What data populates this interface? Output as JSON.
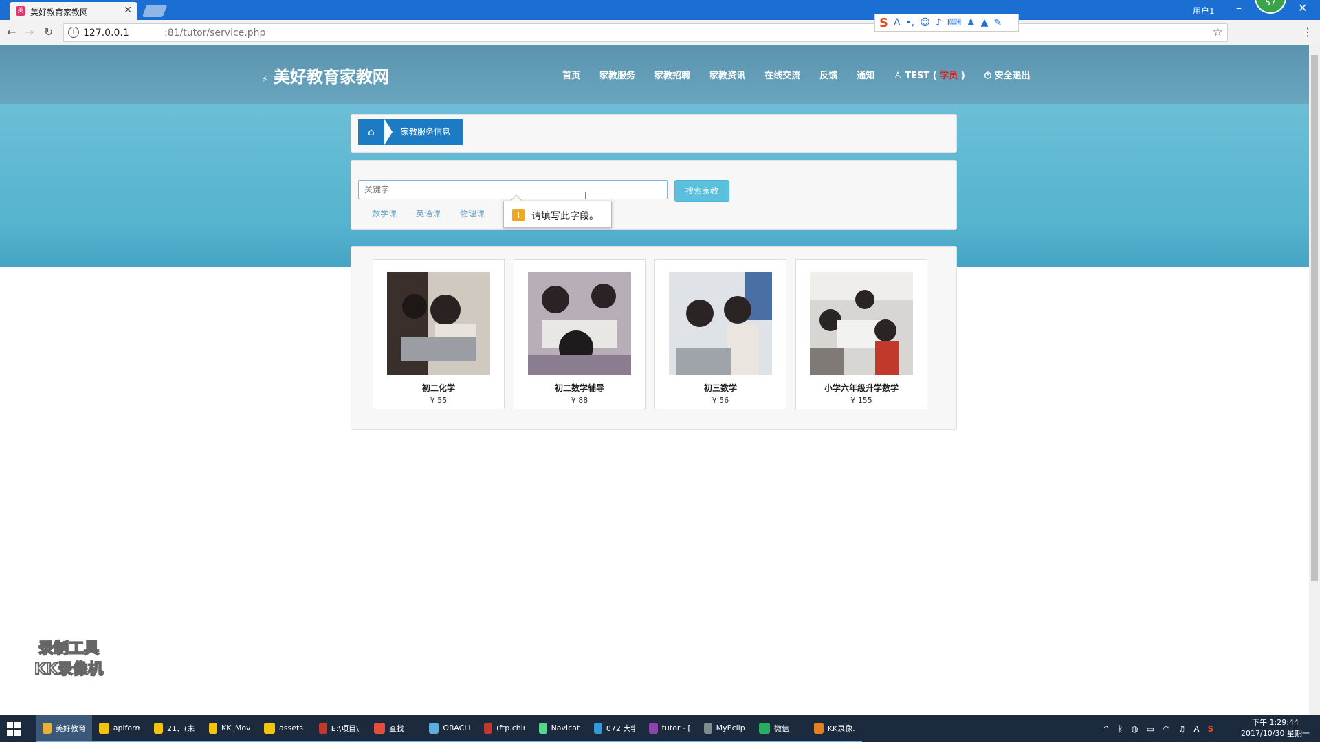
{
  "browser": {
    "tab_title": "美好教育家教网",
    "user_label": "用户1",
    "badge": "57",
    "url_host": "127.0.0.1",
    "url_path": ":81/tutor/service.php"
  },
  "site": {
    "logo": "美好教育家教网",
    "nav": [
      "首页",
      "家教服务",
      "家教招聘",
      "家教资讯",
      "在线交流",
      "反馈",
      "通知"
    ],
    "user_name": "TEST",
    "user_role": "学员",
    "logout": "安全退出"
  },
  "breadcrumb": {
    "label": "家教服务信息"
  },
  "search": {
    "placeholder": "关键字",
    "button": "搜索家教",
    "tags": [
      "数学课",
      "英语课",
      "物理课"
    ],
    "validation_tip": "请填写此字段。"
  },
  "cards": [
    {
      "name": "初二化学",
      "price": "¥ 55"
    },
    {
      "name": "初二数学辅导",
      "price": "¥ 88"
    },
    {
      "name": "初三数学",
      "price": "¥ 56"
    },
    {
      "name": "小学六年级升学数学",
      "price": "¥ 155"
    }
  ],
  "watermark": {
    "line1": "录制工具",
    "line2": "KK录像机"
  },
  "taskbar": {
    "items": [
      "美好教育...",
      "apiform",
      "21、(未...",
      "KK_Movi...",
      "assets",
      "E:\\项目\\1...",
      "查找",
      "ORACLE",
      "(ftp.chin...",
      "Navicat f...",
      "072 大学...",
      "tutor - [...",
      "MyEclips...",
      "微信",
      "KK录像..."
    ],
    "item_colors": [
      "#e8b23a",
      "#f1c40f",
      "#f1c40f",
      "#f1c40f",
      "#f1c40f",
      "#c0392b",
      "#e74c3c",
      "#5dade2",
      "#c0392b",
      "#58d68d",
      "#3498db",
      "#8e44ad",
      "#7f8c8d",
      "#27ae60",
      "#e67e22"
    ],
    "clock_time": "下午 1:29:44",
    "clock_date": "2017/10/30 星期一"
  }
}
